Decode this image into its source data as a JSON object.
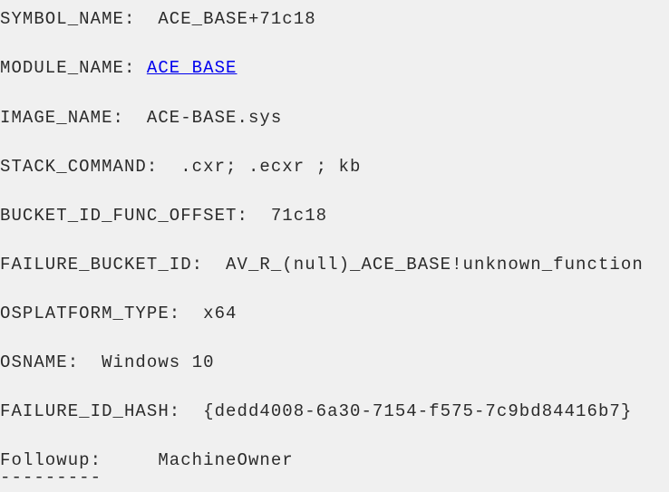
{
  "lines": [
    {
      "label": "SYMBOL_NAME:  ",
      "value": "ACE_BASE+71c18"
    },
    {
      "label": "MODULE_NAME: ",
      "value": "ACE_BASE"
    },
    {
      "label": "IMAGE_NAME:  ",
      "value": "ACE-BASE.sys"
    },
    {
      "label": "STACK_COMMAND:  ",
      "value": ".cxr; .ecxr ; kb"
    },
    {
      "label": "BUCKET_ID_FUNC_OFFSET:  ",
      "value": "71c18"
    },
    {
      "label": "FAILURE_BUCKET_ID:  ",
      "value": "AV_R_(null)_ACE_BASE!unknown_function"
    },
    {
      "label": "OSPLATFORM_TYPE:  ",
      "value": "x64"
    },
    {
      "label": "OSNAME:  ",
      "value": "Windows 10"
    },
    {
      "label": "FAILURE_ID_HASH:  ",
      "value": "{dedd4008-6a30-7154-f575-7c9bd84416b7}"
    },
    {
      "label": "Followup:     ",
      "value": "MachineOwner"
    }
  ],
  "separator": "---------",
  "colors": {
    "background": "#f0f0f0",
    "text": "#2b2b2b",
    "link": "#0000ee"
  }
}
